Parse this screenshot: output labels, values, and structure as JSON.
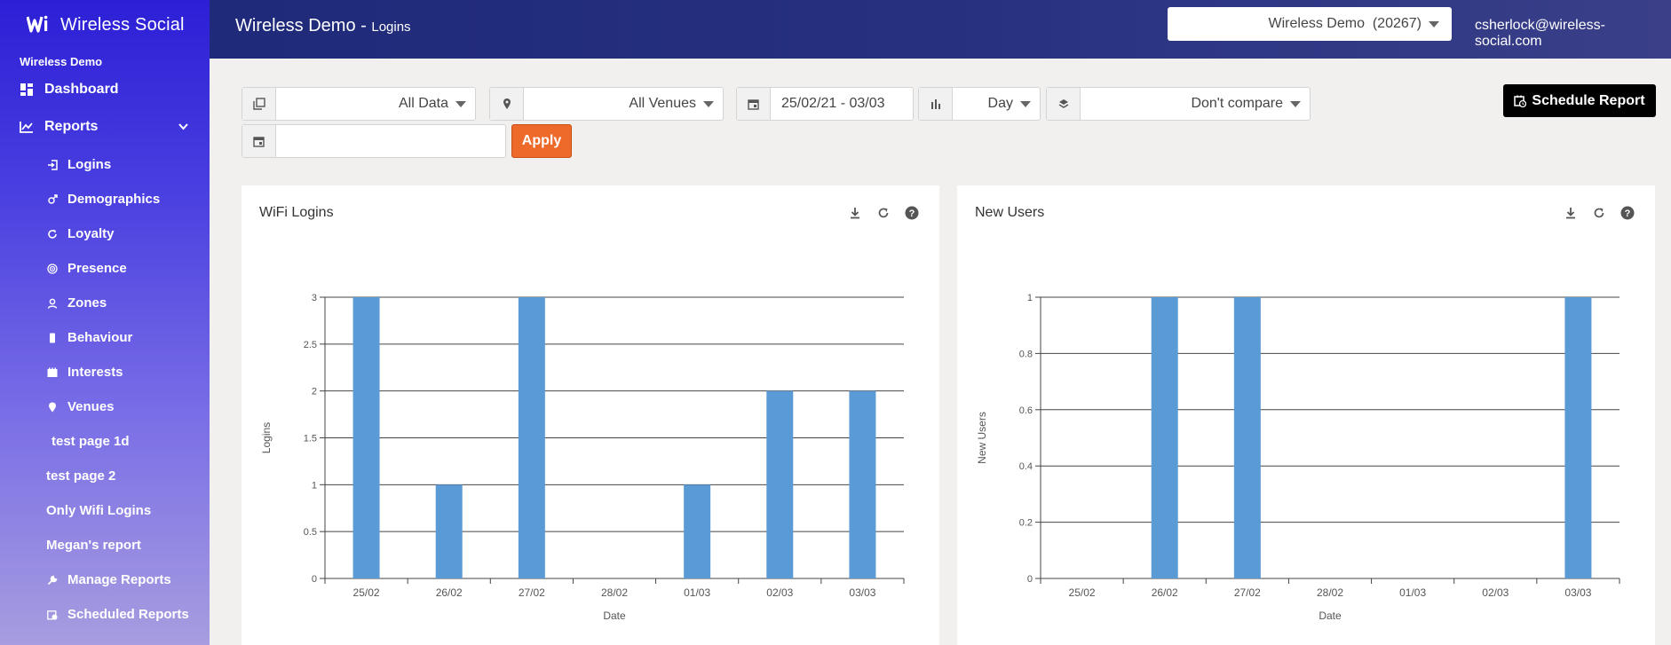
{
  "sidebar": {
    "brand": "Wireless Social",
    "org": "Wireless Demo",
    "dashboard_label": "Dashboard",
    "reports_label": "Reports",
    "items": [
      {
        "label": "Logins",
        "icon": "login-icon"
      },
      {
        "label": "Demographics",
        "icon": "gender-icon"
      },
      {
        "label": "Loyalty",
        "icon": "refresh-icon"
      },
      {
        "label": "Presence",
        "icon": "radar-icon"
      },
      {
        "label": "Zones",
        "icon": "person-pin-icon"
      },
      {
        "label": "Behaviour",
        "icon": "tablet-icon"
      },
      {
        "label": "Interests",
        "icon": "film-icon"
      },
      {
        "label": "Venues",
        "icon": "map-marker-icon"
      },
      {
        "label": "test page 1d",
        "icon": ""
      },
      {
        "label": "test page 2",
        "icon": ""
      },
      {
        "label": "Only Wifi Logins",
        "icon": ""
      },
      {
        "label": "Megan's report",
        "icon": ""
      },
      {
        "label": "Manage Reports",
        "icon": "wrench-icon"
      },
      {
        "label": "Scheduled Reports",
        "icon": "calendar-clock-icon"
      }
    ]
  },
  "header": {
    "title": "Wireless Demo",
    "separator": " - ",
    "subtitle": "Logins",
    "account": "Wireless Demo  (20267)",
    "email": "csherlock@wireless-social.com"
  },
  "filters": {
    "data_scope": "All Data",
    "venues": "All Venues",
    "date_range": "25/02/21 - 03/03",
    "interval": "Day",
    "compare": "Don't compare",
    "compare_date": "",
    "apply_label": "Apply",
    "schedule_label": "Schedule Report"
  },
  "charts_meta": {
    "bar_color": "#5b9bd5"
  },
  "chart_data": [
    {
      "type": "bar",
      "title": "WiFi Logins",
      "categories": [
        "25/02",
        "26/02",
        "27/02",
        "28/02",
        "01/03",
        "02/03",
        "03/03"
      ],
      "values": [
        3,
        1,
        3,
        0,
        1,
        2,
        2
      ],
      "xlabel": "Date",
      "ylabel": "Logins",
      "ylim": [
        0,
        3
      ],
      "yticks": [
        "0",
        "0.5",
        "1",
        "1.5",
        "2",
        "2.5",
        "3"
      ],
      "grid": true
    },
    {
      "type": "bar",
      "title": "New Users",
      "categories": [
        "25/02",
        "26/02",
        "27/02",
        "28/02",
        "01/03",
        "02/03",
        "03/03"
      ],
      "values": [
        0,
        1,
        1,
        0,
        0,
        0,
        1
      ],
      "xlabel": "Date",
      "ylabel": "New Users",
      "ylim": [
        0,
        1
      ],
      "yticks": [
        "0",
        "0.2",
        "0.4",
        "0.6",
        "0.8",
        "1"
      ],
      "grid": true
    }
  ]
}
